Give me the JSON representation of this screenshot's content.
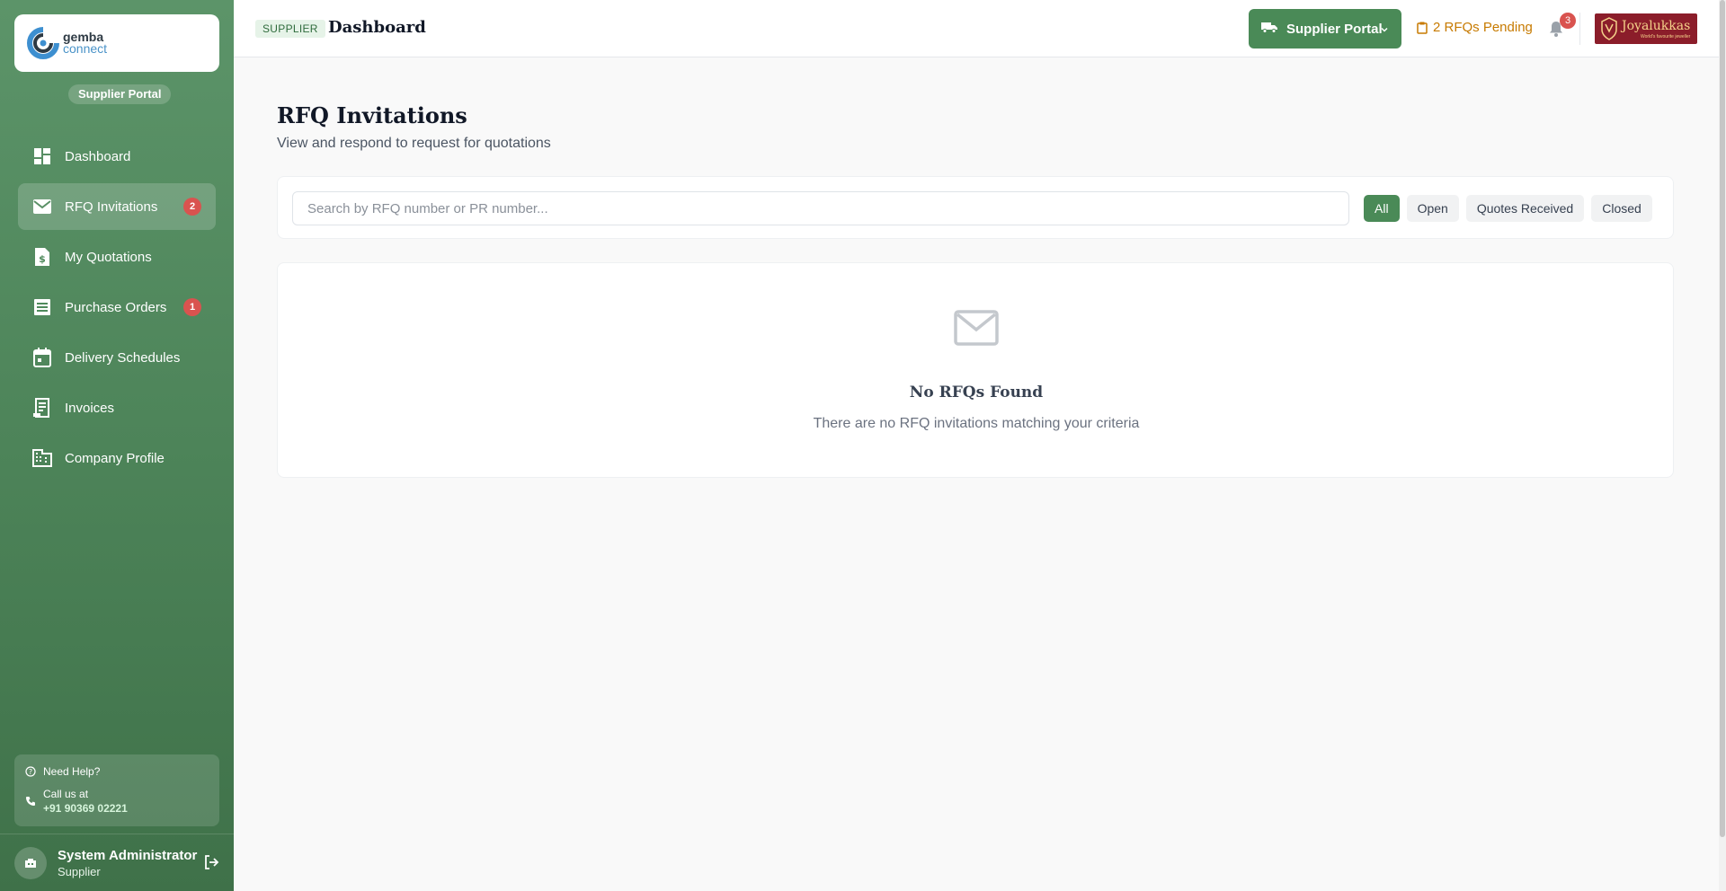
{
  "sidebar": {
    "logo": {
      "line1": "gemba",
      "line2": "connect"
    },
    "portal_label": "Supplier Portal",
    "items": [
      {
        "label": "Dashboard",
        "icon": "dashboard-icon"
      },
      {
        "label": "RFQ Invitations",
        "icon": "mail-icon",
        "badge": "2",
        "active": true
      },
      {
        "label": "My Quotations",
        "icon": "document-dollar-icon"
      },
      {
        "label": "Purchase Orders",
        "icon": "list-document-icon",
        "badge": "1"
      },
      {
        "label": "Delivery Schedules",
        "icon": "calendar-icon"
      },
      {
        "label": "Invoices",
        "icon": "receipt-icon"
      },
      {
        "label": "Company Profile",
        "icon": "building-icon"
      }
    ],
    "help": {
      "title": "Need Help?",
      "call_label": "Call us at",
      "phone": "+91 90369 02221"
    },
    "user": {
      "name": "System Administrator",
      "role": "Supplier"
    }
  },
  "header": {
    "tag": "SUPPLIER",
    "title": "Dashboard",
    "portal_button": "Supplier Portal",
    "pending": "2 RFQs Pending",
    "notifications": "3",
    "brand": {
      "name": "Joyalukkas",
      "tagline": "World's favourite jeweller"
    }
  },
  "page": {
    "title": "RFQ Invitations",
    "subtitle": "View and respond to request for quotations",
    "search": {
      "placeholder": "Search by RFQ number or PR number...",
      "value": ""
    },
    "filters": [
      {
        "label": "All",
        "active": true
      },
      {
        "label": "Open"
      },
      {
        "label": "Quotes Received"
      },
      {
        "label": "Closed"
      }
    ],
    "empty": {
      "title": "No RFQs Found",
      "subtitle": "There are no RFQ invitations matching your criteria"
    }
  },
  "colors": {
    "sidebar": "#4d8459",
    "accent": "#4a8a57",
    "badge": "#d9534f",
    "pending": "#c77a00",
    "brand": "#8b1d2a"
  }
}
